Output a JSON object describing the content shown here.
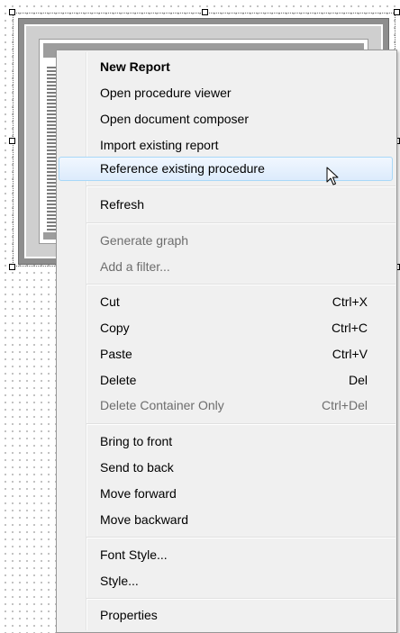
{
  "context_menu": {
    "items": [
      {
        "label": "New Report",
        "shortcut": "",
        "enabled": true,
        "bold": true,
        "highlighted": false
      },
      {
        "label": "Open procedure viewer",
        "shortcut": "",
        "enabled": true,
        "bold": false,
        "highlighted": false
      },
      {
        "label": "Open document composer",
        "shortcut": "",
        "enabled": true,
        "bold": false,
        "highlighted": false
      },
      {
        "label": "Import existing report",
        "shortcut": "",
        "enabled": true,
        "bold": false,
        "highlighted": false
      },
      {
        "label": "Reference existing procedure",
        "shortcut": "",
        "enabled": true,
        "bold": false,
        "highlighted": true
      },
      {
        "label": "Refresh",
        "shortcut": "",
        "enabled": true,
        "bold": false,
        "highlighted": false
      },
      {
        "label": "Generate graph",
        "shortcut": "",
        "enabled": false,
        "bold": false,
        "highlighted": false
      },
      {
        "label": "Add a filter...",
        "shortcut": "",
        "enabled": false,
        "bold": false,
        "highlighted": false
      },
      {
        "label": "Cut",
        "shortcut": "Ctrl+X",
        "enabled": true,
        "bold": false,
        "highlighted": false
      },
      {
        "label": "Copy",
        "shortcut": "Ctrl+C",
        "enabled": true,
        "bold": false,
        "highlighted": false
      },
      {
        "label": "Paste",
        "shortcut": "Ctrl+V",
        "enabled": true,
        "bold": false,
        "highlighted": false
      },
      {
        "label": "Delete",
        "shortcut": "Del",
        "enabled": true,
        "bold": false,
        "highlighted": false
      },
      {
        "label": "Delete Container Only",
        "shortcut": "Ctrl+Del",
        "enabled": false,
        "bold": false,
        "highlighted": false
      },
      {
        "label": "Bring to front",
        "shortcut": "",
        "enabled": true,
        "bold": false,
        "highlighted": false
      },
      {
        "label": "Send to back",
        "shortcut": "",
        "enabled": true,
        "bold": false,
        "highlighted": false
      },
      {
        "label": "Move forward",
        "shortcut": "",
        "enabled": true,
        "bold": false,
        "highlighted": false
      },
      {
        "label": "Move backward",
        "shortcut": "",
        "enabled": true,
        "bold": false,
        "highlighted": false
      },
      {
        "label": "Font Style...",
        "shortcut": "",
        "enabled": true,
        "bold": false,
        "highlighted": false
      },
      {
        "label": "Style...",
        "shortcut": "",
        "enabled": true,
        "bold": false,
        "highlighted": false
      },
      {
        "label": "Properties",
        "shortcut": "",
        "enabled": true,
        "bold": false,
        "highlighted": false
      }
    ]
  },
  "icons": {
    "cursor": "mouse-pointer-icon"
  },
  "colors": {
    "menu_background": "#f0f0f0",
    "menu_border": "#979797",
    "highlight_fill": "#dcebfc",
    "highlight_border": "#a8d8f8",
    "disabled_text": "#6d6d6d",
    "thumbnail_gray": "#8e8e8e"
  }
}
